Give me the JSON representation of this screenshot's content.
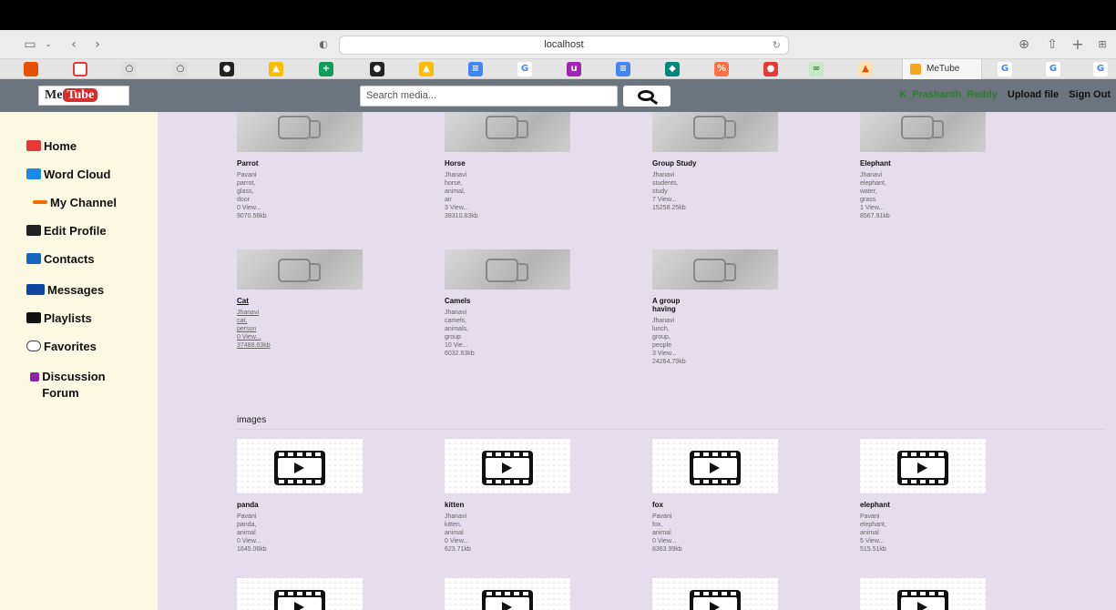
{
  "browser": {
    "address": "localhost",
    "active_tab": "MeTube"
  },
  "navbar": {
    "logo_me": "Me",
    "logo_tube": "Tube",
    "search_placeholder": "Search media...",
    "username": "K_Prashanth_Reddy",
    "upload": "Upload file",
    "signout": "Sign Out"
  },
  "sidebar": {
    "items": [
      {
        "label": "Home",
        "icon": "home-icon",
        "color": "#e53935"
      },
      {
        "label": "Word Cloud",
        "icon": "word-cloud-icon",
        "color": "#1e88e5"
      },
      {
        "label": "My Channel",
        "icon": "channel-icon",
        "color": "#ef6c00"
      },
      {
        "label": "Edit Profile",
        "icon": "user-edit-icon",
        "color": "#222222"
      },
      {
        "label": "Contacts",
        "icon": "contacts-icon",
        "color": "#1565c0"
      },
      {
        "label": "Messages",
        "icon": "messages-icon",
        "color": "#0d47a1"
      },
      {
        "label": "Playlists",
        "icon": "playlist-icon",
        "color": "#111111"
      },
      {
        "label": "Favorites",
        "icon": "favorites-icon",
        "color": "#444444"
      },
      {
        "label": "Discussion Forum",
        "icon": "forum-icon",
        "color": "#8e24aa"
      }
    ]
  },
  "videos": [
    {
      "title": "Parrot",
      "author": "Pavani",
      "tags": [
        "parrot,",
        "glass,",
        "door"
      ],
      "views": "0 View...",
      "size": "9070.56kb"
    },
    {
      "title": "Horse",
      "author": "Jhanavi",
      "tags": [
        "horse,",
        "animal,",
        "air"
      ],
      "views": "3 View...",
      "size": "39310.83kb"
    },
    {
      "title": "Group Study",
      "author": "Jhanavi",
      "tags": [
        "students,",
        "study"
      ],
      "views": "7 View...",
      "size": "15258.25kb"
    },
    {
      "title": "Elephant",
      "author": "Jhanavi",
      "tags": [
        "elephant,",
        "water,",
        "grass"
      ],
      "views": "1 View...",
      "size": "8567.91kb"
    },
    {
      "title": "Cat",
      "author": "Jhanavi",
      "tags": [
        "cat,",
        "person"
      ],
      "views": "0 View...",
      "size": "37488.63kb"
    },
    {
      "title": "Camels",
      "author": "Jhanavi",
      "tags": [
        "camels,",
        "animals,",
        "group"
      ],
      "views": "10 Vie...",
      "size": "6032.63kb"
    },
    {
      "title": "A group having",
      "author": "Jhanavi",
      "tags": [
        "lunch,",
        "group,",
        "people"
      ],
      "views": "3 View...",
      "size": "24264.79kb"
    }
  ],
  "images_section": {
    "label": "images",
    "items": [
      {
        "title": "panda",
        "author": "Pavani",
        "tags": [
          "panda,",
          "animal"
        ],
        "views": "0 View...",
        "size": "1645.06kb"
      },
      {
        "title": "kitten",
        "author": "Jhanavi",
        "tags": [
          "kitten,",
          "animal"
        ],
        "views": "0 View...",
        "size": "623.71kb"
      },
      {
        "title": "fox",
        "author": "Pavani",
        "tags": [
          "fox,",
          "animal"
        ],
        "views": "0 View...",
        "size": "8363.99kb"
      },
      {
        "title": "elephant",
        "author": "Pavani",
        "tags": [
          "elephant,",
          "animal"
        ],
        "views": "5 View...",
        "size": "515.51kb"
      }
    ]
  }
}
